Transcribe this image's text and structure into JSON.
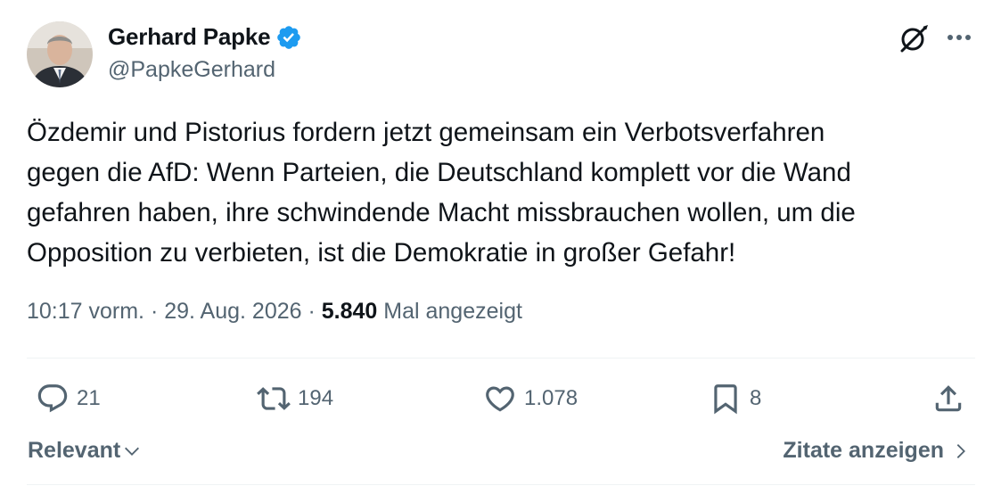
{
  "author": {
    "name": "Gerhard Papke",
    "handle": "@PapkeGerhard",
    "verified": true,
    "verified_color": "#1d9bf0"
  },
  "icons": {
    "verified": "verified-badge-icon",
    "grok": "grok-icon",
    "more": "more-options-icon",
    "reply": "reply-icon",
    "repost": "repost-icon",
    "like": "like-icon",
    "bookmark": "bookmark-icon",
    "share": "share-icon",
    "relevant_chevron": "chevron-down-icon",
    "quotes_chevron": "chevron-right-icon"
  },
  "tweet": {
    "text": "Özdemir und Pistorius fordern jetzt gemeinsam ein Verbotsverfahren\ngegen die AfD: Wenn Parteien, die Deutschland komplett vor die Wand\ngefahren haben, ihre schwindende Macht missbrauchen wollen, um die\nOpposition zu verbieten, ist die Demokratie in großer Gefahr!",
    "time": "10:17 vorm.",
    "separator": " · ",
    "date": "29. Aug. 2026",
    "views_count": "5.840",
    "views_label": " Mal angezeigt"
  },
  "actions": {
    "replies": "21",
    "reposts": "194",
    "likes": "1.078",
    "bookmarks": "8"
  },
  "footer": {
    "sort_label": "Relevant",
    "quotes_label": "Zitate anzeigen"
  },
  "colors": {
    "text_primary": "#0f1419",
    "text_secondary": "#536471",
    "divider": "#eff3f4",
    "accent": "#1d9bf0"
  }
}
